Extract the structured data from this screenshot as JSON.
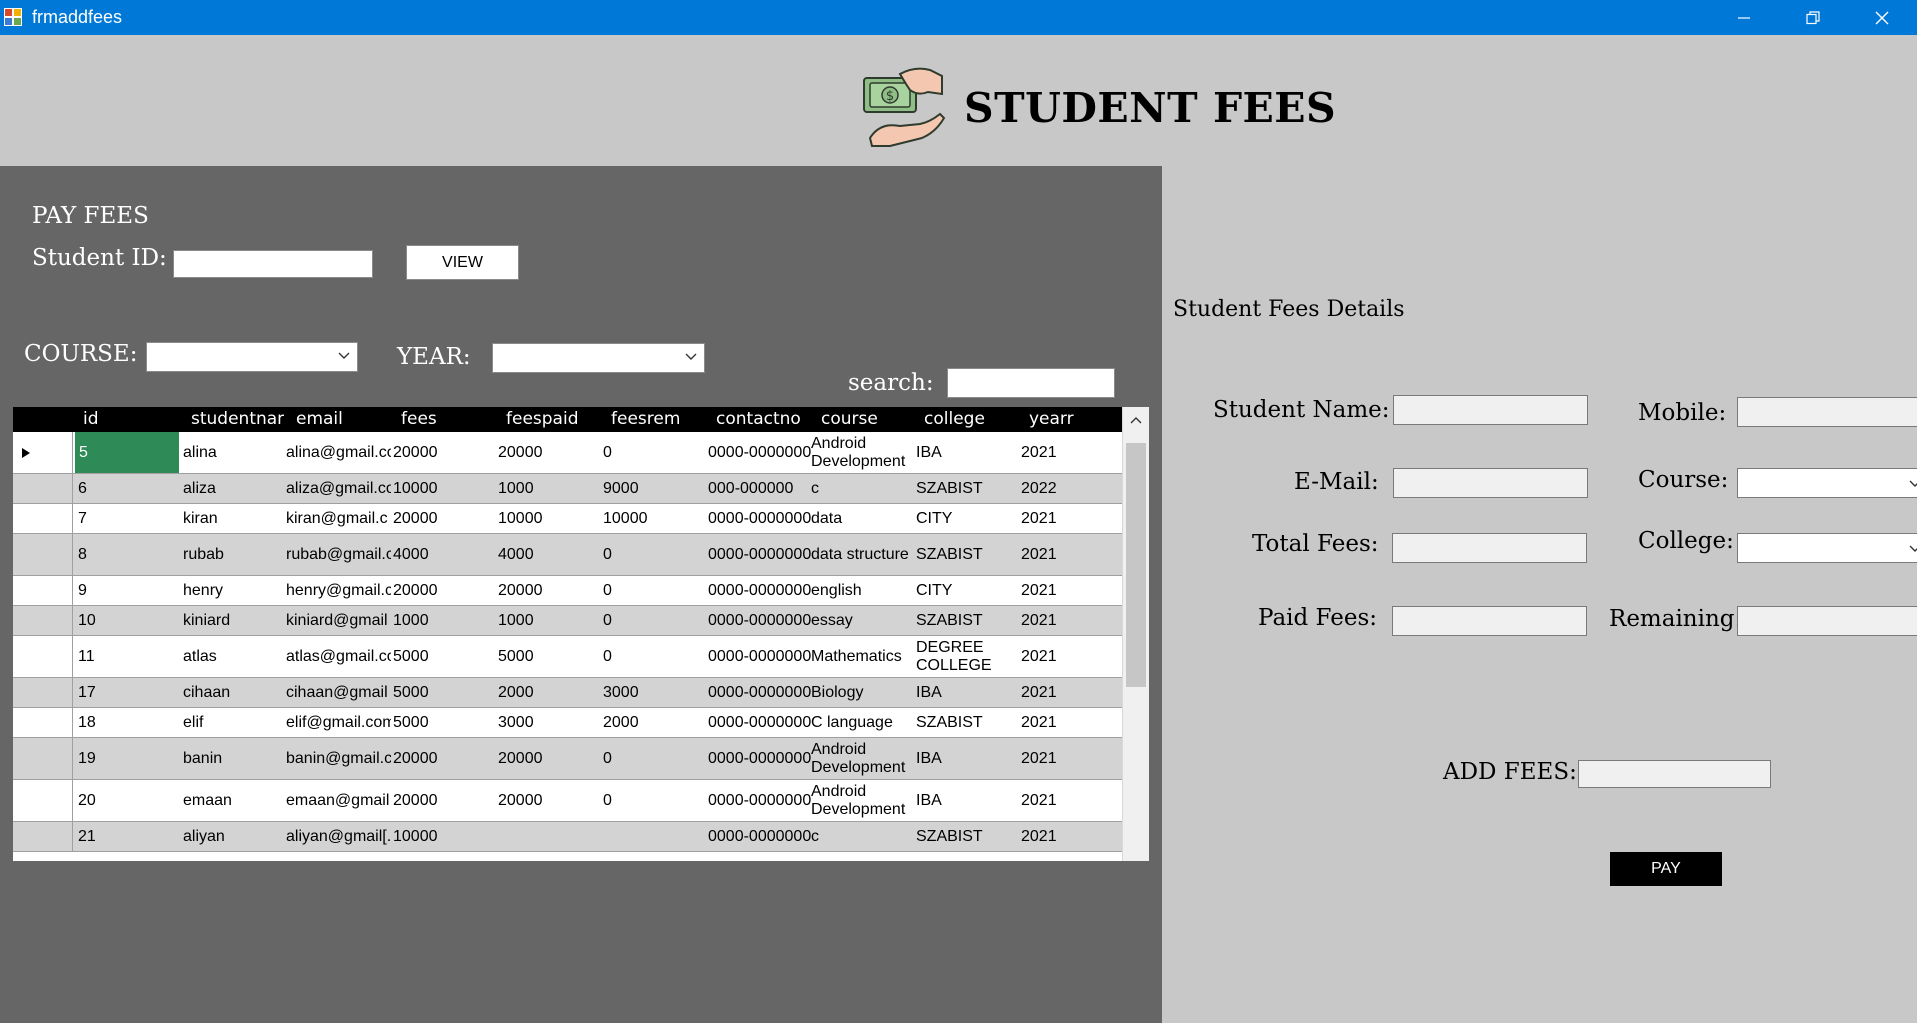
{
  "window": {
    "title": "frmaddfees",
    "minimize_icon": "minimize-icon",
    "restore_icon": "restore-icon",
    "close_icon": "close-icon"
  },
  "header": {
    "title": "STUDENT FEES",
    "icon": "money-hand-icon"
  },
  "left": {
    "pay_fees_label": "PAY FEES",
    "student_id_label": "Student ID:",
    "student_id_value": "",
    "view_button": "VIEW",
    "course_label": "COURSE:",
    "course_value": "",
    "year_label": "YEAR:",
    "year_value": "",
    "search_label": "search:",
    "search_value": ""
  },
  "grid": {
    "columns": [
      "id",
      "studentnan",
      "email",
      "fees",
      "feespaid",
      "feesrem",
      "contactno",
      "course",
      "college",
      "yearr"
    ],
    "rows": [
      [
        "5",
        "alina",
        "alina@gmail.co",
        "20000",
        "20000",
        "0",
        "0000-0000000",
        "Android Development",
        "IBA",
        "2021"
      ],
      [
        "6",
        "aliza",
        "aliza@gmail.co",
        "10000",
        "1000",
        "9000",
        " 000-000000",
        "c",
        "SZABIST",
        "2022"
      ],
      [
        "7",
        "kiran",
        "kiran@gmail.c",
        "20000",
        "10000",
        "10000",
        "0000-0000000",
        "data",
        "CITY",
        "2021"
      ],
      [
        "8",
        "rubab",
        "rubab@gmail.c",
        "4000",
        "4000",
        "0",
        "0000-0000000",
        "data structure",
        "SZABIST",
        "2021"
      ],
      [
        "9",
        "henry",
        "henry@gmail.c",
        "20000",
        "20000",
        "0",
        "0000-0000000",
        "english",
        "CITY",
        "2021"
      ],
      [
        "10",
        "kiniard",
        "kiniard@gmail",
        "1000",
        "1000",
        "0",
        "0000-0000000",
        "essay",
        "SZABIST",
        "2021"
      ],
      [
        "11",
        "atlas",
        "atlas@gmail.co",
        "5000",
        "5000",
        "0",
        "0000-0000000",
        "Mathematics",
        "DEGREE COLLEGE",
        "2021"
      ],
      [
        "17",
        "cihaan",
        "cihaan@gmail",
        "5000",
        "2000",
        "3000",
        "0000-0000000",
        "Biology",
        "IBA",
        "2021"
      ],
      [
        "18",
        "elif",
        "elif@gmail.com",
        "5000",
        "3000",
        "2000",
        "0000-0000000",
        "C language",
        "SZABIST",
        "2021"
      ],
      [
        "19",
        "banin",
        "banin@gmail.c",
        "20000",
        "20000",
        "0",
        "0000-0000000",
        "Android Development",
        "IBA",
        "2021"
      ],
      [
        "20",
        "emaan",
        "emaan@gmail",
        "20000",
        "20000",
        "0",
        "0000-0000000",
        "Android Development",
        "IBA",
        "2021"
      ],
      [
        "21",
        "aliyan",
        "aliyan@gmail[.",
        "10000",
        "",
        "",
        "0000-0000000",
        "c",
        "SZABIST",
        "2021"
      ]
    ]
  },
  "right": {
    "section_title": "Student Fees Details",
    "student_name_label": "Student Name:",
    "mobile_label": "Mobile:",
    "email_label": "E-Mail:",
    "course_label": "Course:",
    "total_fees_label": "Total Fees:",
    "college_label": "College:",
    "paid_fees_label": "Paid Fees:",
    "remaining_label": "Remaining:",
    "add_fees_label": "ADD FEES:",
    "pay_button": "PAY"
  },
  "colors": {
    "titlebar": "#0078d7",
    "panel": "#666666",
    "background": "#c8c8c8",
    "selected_cell": "#2e8b57",
    "alt_row": "#d3d3d3"
  }
}
